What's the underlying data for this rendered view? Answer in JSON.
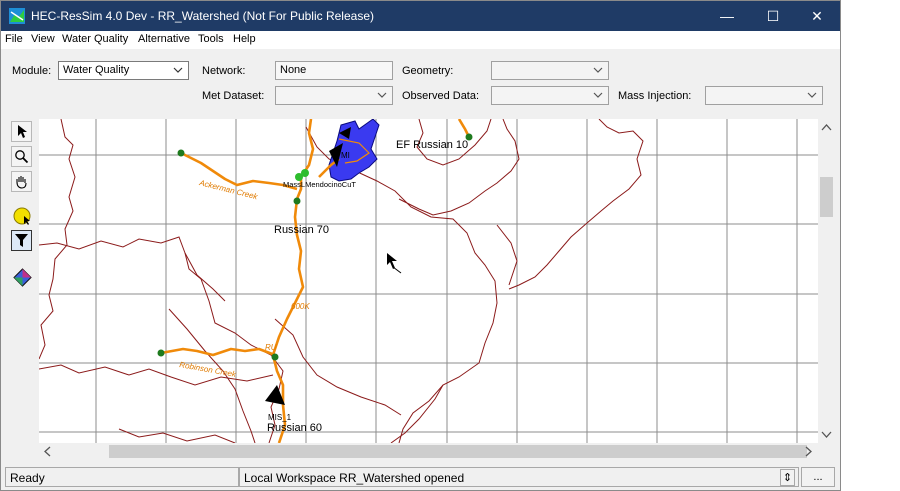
{
  "window": {
    "title": "HEC-ResSim 4.0 Dev  - RR_Watershed (Not For Public Release)",
    "minimize_glyph": "—",
    "maximize_glyph": "☐",
    "close_glyph": "✕"
  },
  "menu": [
    "File",
    "View",
    "Water Quality",
    "Alternative",
    "Tools",
    "Help"
  ],
  "toolbar": {
    "module_label": "Module:",
    "module_value": "Water Quality",
    "network_label": "Network:",
    "network_value": "None",
    "geometry_label": "Geometry:",
    "geometry_value": "",
    "met_dataset_label": "Met Dataset:",
    "met_dataset_value": "",
    "observed_data_label": "Observed Data:",
    "observed_data_value": "",
    "mass_injection_label": "Mass Injection:",
    "mass_injection_value": ""
  },
  "tools": [
    "pointer-tool",
    "zoom-tool",
    "pan-tool",
    "select-region-tool",
    "filter-tool",
    "layer-tool"
  ],
  "map": {
    "labels": {
      "ef_russian": "EF Russian 10",
      "mass_mendocino": "MassLMendocinoCuT",
      "mi": "MI",
      "russian_70": "Russian 70",
      "russian_60": "Russian 60",
      "mis": "MIS_1",
      "ackerman": "Ackerman Creek",
      "robinson": "Robinson Creek",
      "k600": "600K",
      "ru": "RU"
    },
    "colors": {
      "river": "#f08a0a",
      "boundary": "#8b1a1a",
      "grid": "#8c8c8c",
      "reservoir": "#3a3af0",
      "junction": "#1e7a1e"
    }
  },
  "status": {
    "left": "Ready",
    "message": "Local Workspace RR_Watershed opened",
    "spinner": "⇕",
    "more_button": "..."
  }
}
